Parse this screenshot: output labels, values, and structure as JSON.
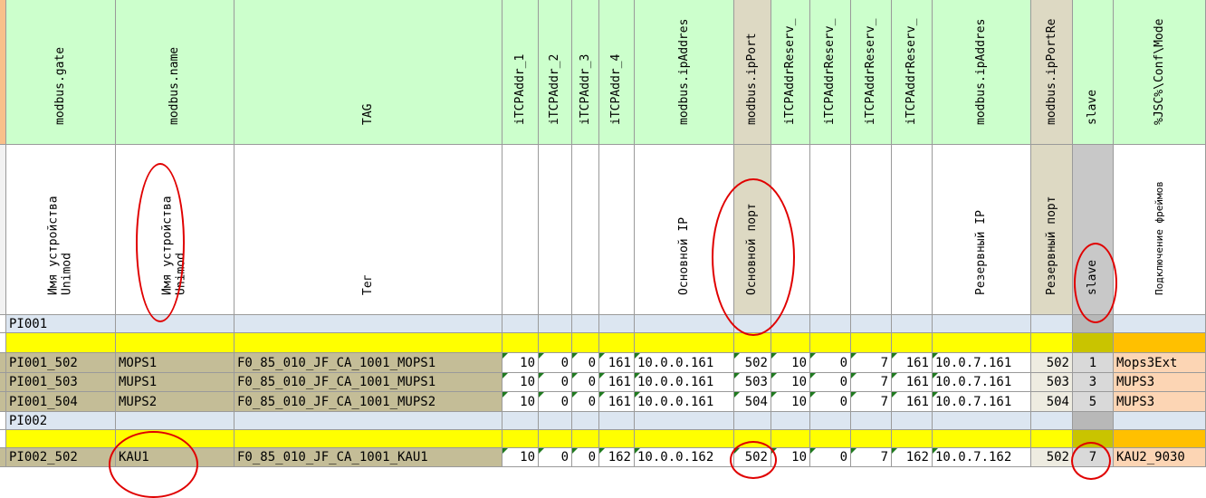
{
  "colors": {
    "header_green": "#ccffcc",
    "header_tan": "#ddd9c3",
    "header_gray": "#c8c8c8",
    "group_blue": "#dce6f1",
    "yellow": "#ffff00",
    "row_tan": "#c4bd97",
    "orange": "#fcd5b4",
    "orange_dark": "#ffc000",
    "annotation_red": "#e00000"
  },
  "columns": [
    {
      "field": "modbus.gate",
      "desc": [
        "Имя устройства",
        "Unimod"
      ]
    },
    {
      "field": "modbus.name",
      "desc": [
        "Имя устройства",
        "Unimod"
      ]
    },
    {
      "field": "TAG",
      "desc": [
        "Тег"
      ]
    },
    {
      "field": "iTCPAddr_1",
      "desc": []
    },
    {
      "field": "iTCPAddr_2",
      "desc": []
    },
    {
      "field": "iTCPAddr_3",
      "desc": []
    },
    {
      "field": "iTCPAddr_4",
      "desc": []
    },
    {
      "field": "modbus.ipAddres",
      "desc": [
        "Основной IP"
      ]
    },
    {
      "field": "modbus.ipPort",
      "desc": [
        "Основной порт"
      ]
    },
    {
      "field": "iTCPAddrReserv_",
      "desc": []
    },
    {
      "field": "iTCPAddrReserv_",
      "desc": []
    },
    {
      "field": "iTCPAddrReserv_",
      "desc": []
    },
    {
      "field": "iTCPAddrReserv_",
      "desc": []
    },
    {
      "field": "modbus.ipAddres",
      "desc": [
        "Резервный IP"
      ]
    },
    {
      "field": "modbus.ipPortRe",
      "desc": [
        "Резервный порт"
      ]
    },
    {
      "field": "slave",
      "desc": [
        "slave"
      ]
    },
    {
      "field": "%JSC%\\Conf\\Mode",
      "desc": [
        "Подключение фреймов"
      ]
    }
  ],
  "rows": [
    {
      "type": "group",
      "cells": [
        "PI001"
      ]
    },
    {
      "type": "yellow",
      "cells": []
    },
    {
      "type": "data",
      "cells": [
        "PI001_502",
        "MOPS1",
        "F0_85_010_JF_CA_1001_MOPS1",
        "10",
        "0",
        "0",
        "161",
        "10.0.0.161",
        "502",
        "10",
        "0",
        "7",
        "161",
        "10.0.7.161",
        "502",
        "1",
        "Mops3Ext"
      ]
    },
    {
      "type": "data",
      "cells": [
        "PI001_503",
        "MUPS1",
        "F0_85_010_JF_CA_1001_MUPS1",
        "10",
        "0",
        "0",
        "161",
        "10.0.0.161",
        "503",
        "10",
        "0",
        "7",
        "161",
        "10.0.7.161",
        "503",
        "3",
        "MUPS3"
      ]
    },
    {
      "type": "data",
      "cells": [
        "PI001_504",
        "MUPS2",
        "F0_85_010_JF_CA_1001_MUPS2",
        "10",
        "0",
        "0",
        "161",
        "10.0.0.161",
        "504",
        "10",
        "0",
        "7",
        "161",
        "10.0.7.161",
        "504",
        "5",
        "MUPS3"
      ]
    },
    {
      "type": "group",
      "cells": [
        "PI002"
      ]
    },
    {
      "type": "yellow",
      "cells": []
    },
    {
      "type": "data",
      "cells": [
        "PI002_502",
        "KAU1",
        "F0_85_010_JF_CA_1001_KAU1",
        "10",
        "0",
        "0",
        "162",
        "10.0.0.162",
        "502",
        "10",
        "0",
        "7",
        "162",
        "10.0.7.162",
        "502",
        "7",
        "KAU2_9030"
      ]
    }
  ]
}
